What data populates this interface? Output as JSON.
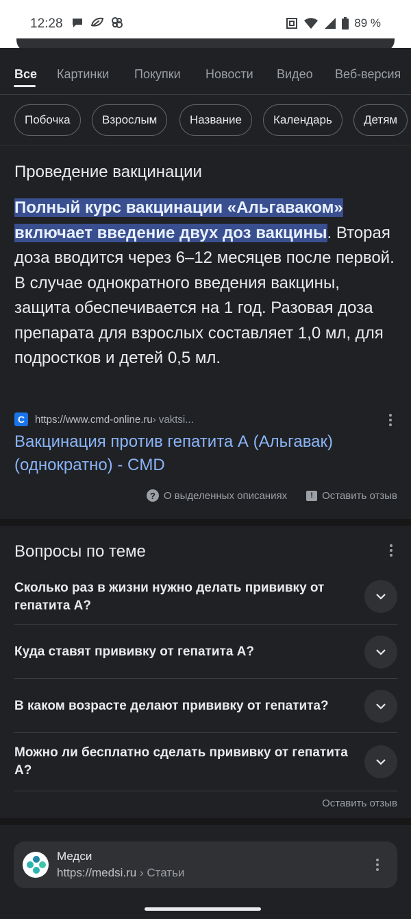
{
  "status_bar": {
    "time": "12:28",
    "battery": "89 %",
    "left_icons": [
      "chat-bubble-icon",
      "leaf-icon",
      "pinwheel-icon"
    ],
    "right_icons": [
      "nfc-icon",
      "wifi-icon",
      "signal-icon",
      "battery-icon"
    ]
  },
  "tabs": [
    "Все",
    "Картинки",
    "Покупки",
    "Новости",
    "Видео",
    "Веб-версия"
  ],
  "active_tab": "Все",
  "chips": [
    "Побочка",
    "Взрослым",
    "Название",
    "Календарь",
    "Детям"
  ],
  "snippet": {
    "title": "Проведение вакцинации",
    "highlight_line1": "Полный курс вакцинации «Альгаваком»",
    "highlight_line2": "включает введение двух доз вакцины",
    "rest": ". Вторая доза вводится через 6–12 месяцев после первой. В случае однократного введения вакцины, защита обеспечивается на 1 год. Разовая доза препарата для взрослых составляет 1,0 мл, для подростков и детей 0,5 мл.",
    "favicon_letter": "C",
    "source_url": "https://www.cmd-online.ru",
    "source_crumb": " › vaktsi...",
    "link_text": "Вакцинация против гепатита А (Альгавак) (однократно) - CMD",
    "about_label": "О выделенных описаниях",
    "feedback_label": "Оставить отзыв"
  },
  "related": {
    "title": "Вопросы по теме",
    "questions": [
      "Сколько раз в жизни нужно делать прививку от гепатита А?",
      "Куда ставят прививку от гепатита А?",
      "В каком возрасте делают прививку от гепатита?",
      "Можно ли бесплатно сделать прививку от гепатита А?"
    ],
    "feedback_label": "Оставить отзыв"
  },
  "medsi": {
    "name": "Медси",
    "url": "https://medsi.ru",
    "crumb": " › Статьи"
  },
  "colors": {
    "background": "#202124",
    "highlight": "#394f8f",
    "link": "#8ab4f8"
  }
}
